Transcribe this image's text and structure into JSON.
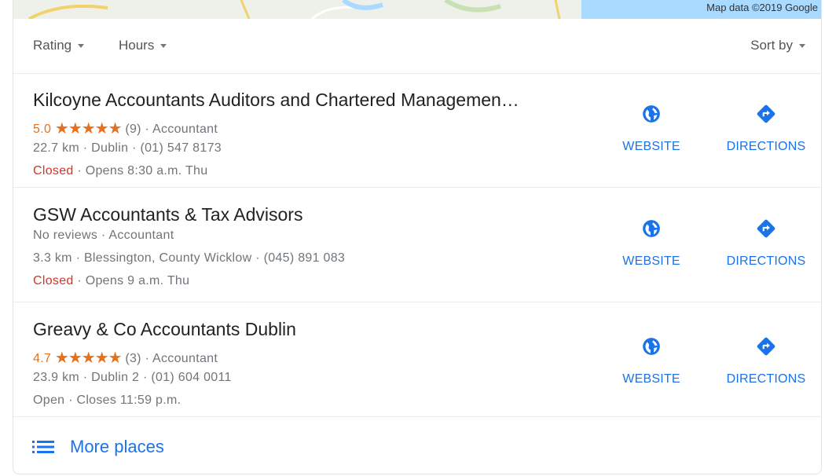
{
  "map": {
    "credit": "Map data ©2019 Google"
  },
  "filters": {
    "rating_label": "Rating",
    "hours_label": "Hours",
    "sort_label": "Sort by"
  },
  "listings": [
    {
      "name": "Kilcoyne Accountants Auditors and Chartered Managemen…",
      "rating": "5.0",
      "stars": "★★★★★",
      "reviews": "(9)",
      "reviews_text": "",
      "category": "Accountant",
      "distance": "22.7 km",
      "location": "Dublin",
      "phone": "(01) 547 8173",
      "status": "Closed",
      "status_closed": true,
      "hours": "Opens 8:30 a.m. Thu"
    },
    {
      "name": "GSW Accountants & Tax Advisors",
      "rating": "",
      "stars": "",
      "reviews": "",
      "reviews_text": "No reviews",
      "category": "Accountant",
      "distance": "3.3 km",
      "location": "Blessington, County Wicklow",
      "phone": "(045) 891 083",
      "status": "Closed",
      "status_closed": true,
      "hours": "Opens 9 a.m. Thu"
    },
    {
      "name": "Greavy & Co Accountants Dublin",
      "rating": "4.7",
      "stars": "★★★★★",
      "reviews": "(3)",
      "reviews_text": "",
      "category": "Accountant",
      "distance": "23.9 km",
      "location": "Dublin 2",
      "phone": "(01) 604 0011",
      "status": "Open",
      "status_closed": false,
      "hours": "Closes 11:59 p.m."
    }
  ],
  "actions": {
    "website_label": "WEBSITE",
    "directions_label": "DIRECTIONS"
  },
  "more": {
    "label": "More places"
  },
  "colors": {
    "accent": "#1a73e8",
    "star": "#e7711b",
    "closed": "#d93025"
  }
}
